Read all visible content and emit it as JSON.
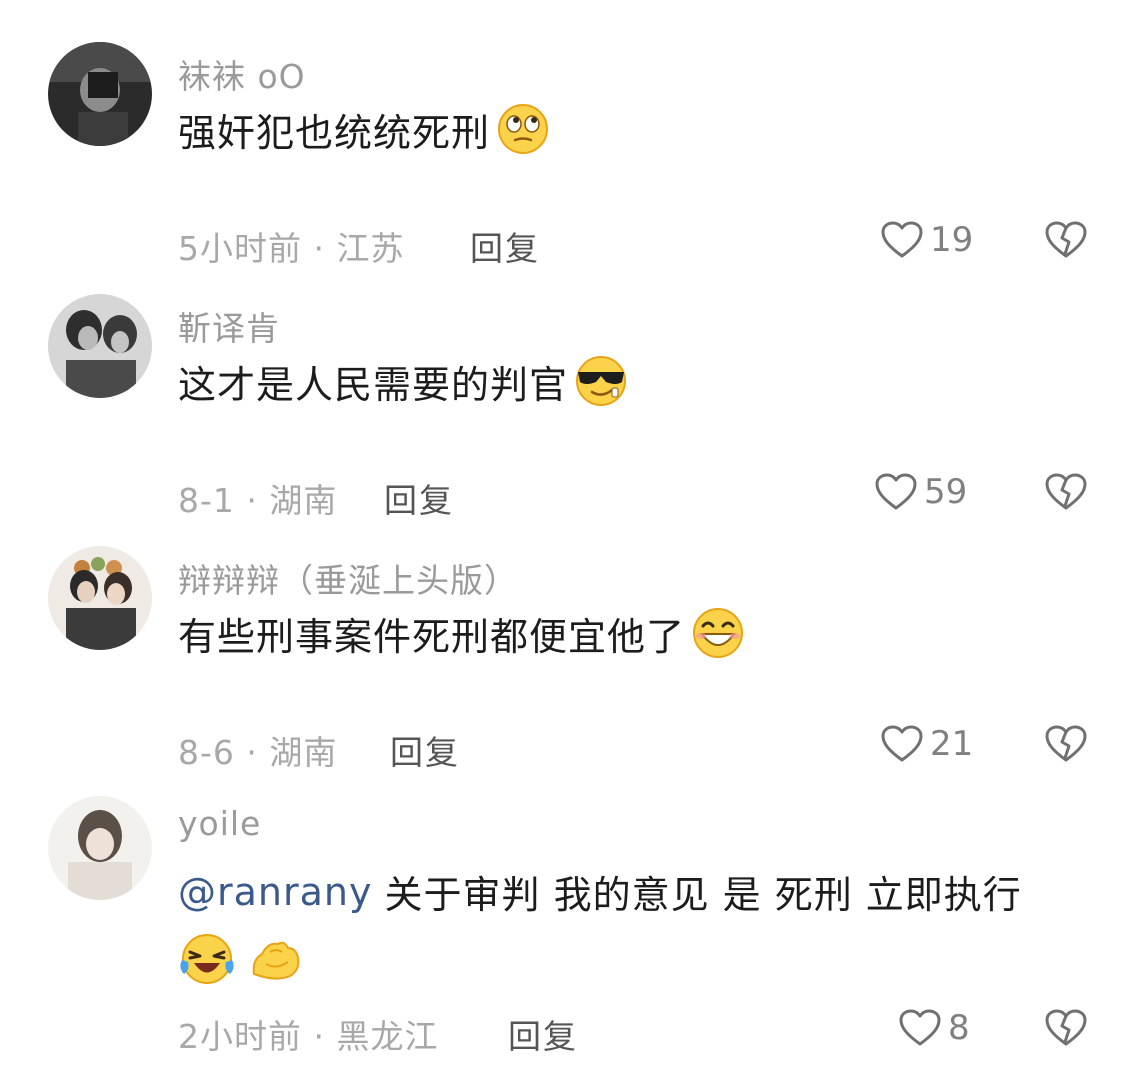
{
  "comments": [
    {
      "username": "袜袜 oO",
      "text": "强奸犯也统统死刑",
      "emojis": [
        "rolling-eyes-emoji"
      ],
      "meta": "5小时前 · 江苏",
      "reply_label": "回复",
      "likes": "19",
      "icons": {
        "like": "heart-outline-icon",
        "dislike": "broken-heart-icon"
      }
    },
    {
      "username": "靳译肯",
      "text": "这才是人民需要的判官",
      "emojis": [
        "sunglasses-emoji"
      ],
      "meta": "8-1 · 湖南",
      "reply_label": "回复",
      "likes": "59",
      "icons": {
        "like": "heart-outline-icon",
        "dislike": "broken-heart-icon"
      }
    },
    {
      "username": "辩辩辩（垂涎上头版）",
      "text": "有些刑事案件死刑都便宜他了",
      "emojis": [
        "grinning-emoji"
      ],
      "meta": "8-6 · 湖南",
      "reply_label": "回复",
      "likes": "21",
      "icons": {
        "like": "heart-outline-icon",
        "dislike": "broken-heart-icon"
      }
    },
    {
      "username": "yoile",
      "mention": "@ranrany",
      "text": "关于审判 我的意见 是 死刑 立即执行",
      "emojis": [
        "laughing-crying-emoji",
        "flexed-biceps-emoji"
      ],
      "meta": "2小时前 · 黑龙江",
      "reply_label": "回复",
      "likes": "8",
      "icons": {
        "like": "heart-outline-icon",
        "dislike": "broken-heart-icon"
      }
    }
  ],
  "colors": {
    "username": "#9a9a9a",
    "text": "#1c1c1c",
    "meta": "#a8a8a8",
    "mention": "#3b5a8c",
    "icon": "#707070"
  }
}
